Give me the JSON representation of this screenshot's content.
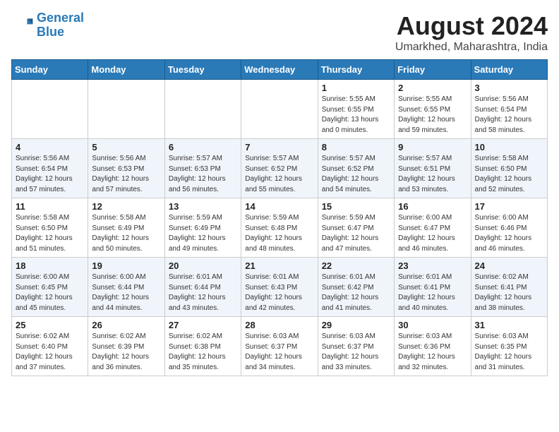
{
  "header": {
    "logo_line1": "General",
    "logo_line2": "Blue",
    "title": "August 2024",
    "subtitle": "Umarkhed, Maharashtra, India"
  },
  "days_of_week": [
    "Sunday",
    "Monday",
    "Tuesday",
    "Wednesday",
    "Thursday",
    "Friday",
    "Saturday"
  ],
  "weeks": [
    [
      {
        "day": "",
        "info": ""
      },
      {
        "day": "",
        "info": ""
      },
      {
        "day": "",
        "info": ""
      },
      {
        "day": "",
        "info": ""
      },
      {
        "day": "1",
        "info": "Sunrise: 5:55 AM\nSunset: 6:55 PM\nDaylight: 13 hours\nand 0 minutes."
      },
      {
        "day": "2",
        "info": "Sunrise: 5:55 AM\nSunset: 6:55 PM\nDaylight: 12 hours\nand 59 minutes."
      },
      {
        "day": "3",
        "info": "Sunrise: 5:56 AM\nSunset: 6:54 PM\nDaylight: 12 hours\nand 58 minutes."
      }
    ],
    [
      {
        "day": "4",
        "info": "Sunrise: 5:56 AM\nSunset: 6:54 PM\nDaylight: 12 hours\nand 57 minutes."
      },
      {
        "day": "5",
        "info": "Sunrise: 5:56 AM\nSunset: 6:53 PM\nDaylight: 12 hours\nand 57 minutes."
      },
      {
        "day": "6",
        "info": "Sunrise: 5:57 AM\nSunset: 6:53 PM\nDaylight: 12 hours\nand 56 minutes."
      },
      {
        "day": "7",
        "info": "Sunrise: 5:57 AM\nSunset: 6:52 PM\nDaylight: 12 hours\nand 55 minutes."
      },
      {
        "day": "8",
        "info": "Sunrise: 5:57 AM\nSunset: 6:52 PM\nDaylight: 12 hours\nand 54 minutes."
      },
      {
        "day": "9",
        "info": "Sunrise: 5:57 AM\nSunset: 6:51 PM\nDaylight: 12 hours\nand 53 minutes."
      },
      {
        "day": "10",
        "info": "Sunrise: 5:58 AM\nSunset: 6:50 PM\nDaylight: 12 hours\nand 52 minutes."
      }
    ],
    [
      {
        "day": "11",
        "info": "Sunrise: 5:58 AM\nSunset: 6:50 PM\nDaylight: 12 hours\nand 51 minutes."
      },
      {
        "day": "12",
        "info": "Sunrise: 5:58 AM\nSunset: 6:49 PM\nDaylight: 12 hours\nand 50 minutes."
      },
      {
        "day": "13",
        "info": "Sunrise: 5:59 AM\nSunset: 6:49 PM\nDaylight: 12 hours\nand 49 minutes."
      },
      {
        "day": "14",
        "info": "Sunrise: 5:59 AM\nSunset: 6:48 PM\nDaylight: 12 hours\nand 48 minutes."
      },
      {
        "day": "15",
        "info": "Sunrise: 5:59 AM\nSunset: 6:47 PM\nDaylight: 12 hours\nand 47 minutes."
      },
      {
        "day": "16",
        "info": "Sunrise: 6:00 AM\nSunset: 6:47 PM\nDaylight: 12 hours\nand 46 minutes."
      },
      {
        "day": "17",
        "info": "Sunrise: 6:00 AM\nSunset: 6:46 PM\nDaylight: 12 hours\nand 46 minutes."
      }
    ],
    [
      {
        "day": "18",
        "info": "Sunrise: 6:00 AM\nSunset: 6:45 PM\nDaylight: 12 hours\nand 45 minutes."
      },
      {
        "day": "19",
        "info": "Sunrise: 6:00 AM\nSunset: 6:44 PM\nDaylight: 12 hours\nand 44 minutes."
      },
      {
        "day": "20",
        "info": "Sunrise: 6:01 AM\nSunset: 6:44 PM\nDaylight: 12 hours\nand 43 minutes."
      },
      {
        "day": "21",
        "info": "Sunrise: 6:01 AM\nSunset: 6:43 PM\nDaylight: 12 hours\nand 42 minutes."
      },
      {
        "day": "22",
        "info": "Sunrise: 6:01 AM\nSunset: 6:42 PM\nDaylight: 12 hours\nand 41 minutes."
      },
      {
        "day": "23",
        "info": "Sunrise: 6:01 AM\nSunset: 6:41 PM\nDaylight: 12 hours\nand 40 minutes."
      },
      {
        "day": "24",
        "info": "Sunrise: 6:02 AM\nSunset: 6:41 PM\nDaylight: 12 hours\nand 38 minutes."
      }
    ],
    [
      {
        "day": "25",
        "info": "Sunrise: 6:02 AM\nSunset: 6:40 PM\nDaylight: 12 hours\nand 37 minutes."
      },
      {
        "day": "26",
        "info": "Sunrise: 6:02 AM\nSunset: 6:39 PM\nDaylight: 12 hours\nand 36 minutes."
      },
      {
        "day": "27",
        "info": "Sunrise: 6:02 AM\nSunset: 6:38 PM\nDaylight: 12 hours\nand 35 minutes."
      },
      {
        "day": "28",
        "info": "Sunrise: 6:03 AM\nSunset: 6:37 PM\nDaylight: 12 hours\nand 34 minutes."
      },
      {
        "day": "29",
        "info": "Sunrise: 6:03 AM\nSunset: 6:37 PM\nDaylight: 12 hours\nand 33 minutes."
      },
      {
        "day": "30",
        "info": "Sunrise: 6:03 AM\nSunset: 6:36 PM\nDaylight: 12 hours\nand 32 minutes."
      },
      {
        "day": "31",
        "info": "Sunrise: 6:03 AM\nSunset: 6:35 PM\nDaylight: 12 hours\nand 31 minutes."
      }
    ]
  ]
}
